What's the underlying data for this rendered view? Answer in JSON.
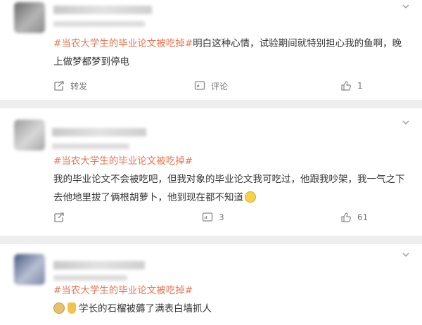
{
  "comments": [
    {
      "topic": "#当农大学生的毕业论文被吃掉#",
      "text": "明白这种心情，试验期间就特别担心我的鱼啊，晚上做梦都梦到停电",
      "actions": {
        "repost": "转发",
        "comment": "评论",
        "likes": "1"
      }
    },
    {
      "topic": "#当农大学生的毕业论文被吃掉#",
      "text": "我的毕业论文不会被吃吧，但我对象的毕业论文我可吃过，他跟我吵架，我一气之下去他地里拔了俩根胡萝卜，他到现在都不知道",
      "actions": {
        "repost": "",
        "comment": "3",
        "likes": "61"
      }
    },
    {
      "topic": "#当农大学生的毕业论文被吃掉#",
      "text": "学长的石榴被薅了满表白墙抓人",
      "actions": {}
    }
  ],
  "icons": [
    "chevron-down-icon",
    "repost-icon",
    "comment-icon",
    "like-icon",
    "doge-emoji",
    "smile-emoji",
    "thumbs-up-emoji"
  ],
  "colors": {
    "topic": "#eb7350",
    "text": "#333333",
    "meta": "#777777",
    "divider": "#eeeeee"
  }
}
